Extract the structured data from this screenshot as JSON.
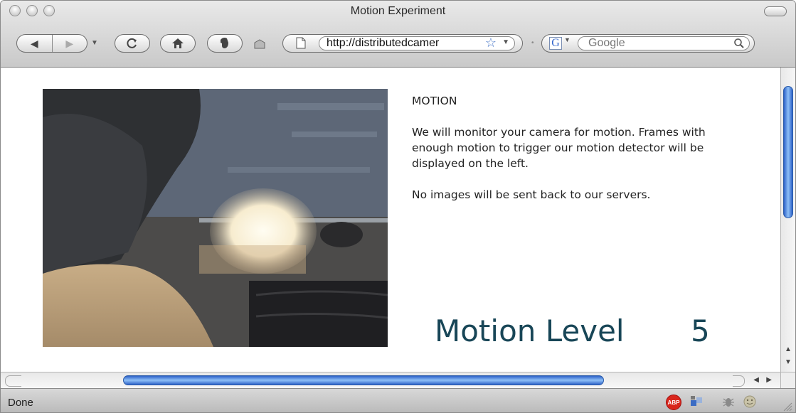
{
  "window": {
    "title": "Motion Experiment"
  },
  "toolbar": {
    "url": "http://distributedcamer",
    "search_placeholder": "Google",
    "search_engine_letter": "G"
  },
  "content": {
    "heading": "MOTION",
    "paragraph1": "We will monitor your camera for motion. Frames with enough motion to trigger our motion detector will be displayed on the left.",
    "paragraph2": "No images will be sent back to our servers.",
    "motion_label": "Motion Level",
    "motion_value": "5"
  },
  "statusbar": {
    "status": "Done",
    "adblock_label": "ABP"
  },
  "icons": [
    "back-icon",
    "forward-icon",
    "reload-icon",
    "home-icon",
    "evernote-icon",
    "clip-icon",
    "page-icon",
    "bookmark-star-icon",
    "google-icon",
    "search-icon",
    "adblock-icon",
    "firebug-icon",
    "bug-icon",
    "smiley-icon"
  ]
}
